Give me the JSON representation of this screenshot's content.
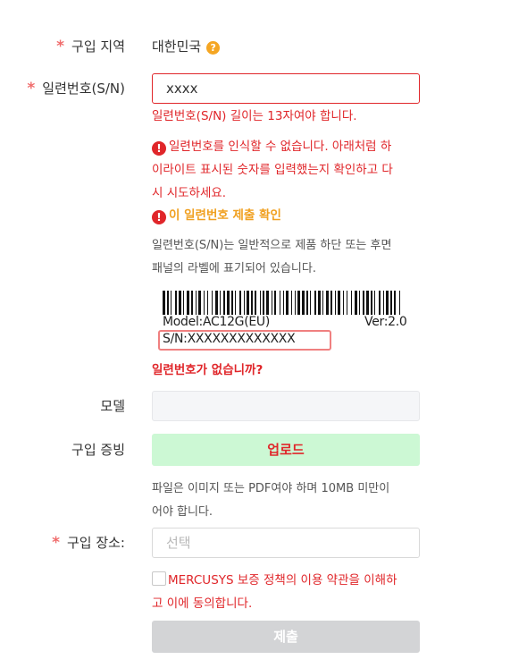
{
  "region": {
    "label": "구입 지역",
    "value": "대한민국",
    "help_icon": "question-icon"
  },
  "serial": {
    "label": "일련번호(S/N)",
    "value": "xxxx",
    "length_error": "일련번호(S/N) 길이는 13자여야 합니다.",
    "recognize_error_1": "일련번호를 인식할 수 없습니다. 아래처럼 하",
    "recognize_error_2": "이라이트 표시된 숫자를 입력했는지 확인하고 다",
    "recognize_error_3": "시 시도하세요.",
    "confirm_link": "이 일련번호 제출 확인",
    "hint_1": "일련번호(S/N)는 일반적으로 제품 하단 또는 후면",
    "hint_2": "패널의 라벨에 표기되어 있습니다.",
    "label_model": "Model:AC12G(EU)",
    "label_ver": "Ver:2.0",
    "label_sn": "S/N:XXXXXXXXXXXXX",
    "no_serial_link": "일련번호가 없습니까?"
  },
  "model": {
    "label": "모델",
    "value": ""
  },
  "proof": {
    "label": "구입 증빙",
    "upload_label": "업로드",
    "hint_1": "파일은 이미지 또는 PDF여야 하며 10MB 미만이",
    "hint_2": "어야 합니다."
  },
  "place": {
    "label": "구입 장소:",
    "placeholder": "선택"
  },
  "agree": {
    "text_1": "MERCUSYS 보증 정책의 이용 약관을 이해하",
    "text_2": "고 이에 동의합니다."
  },
  "submit": {
    "label": "제출"
  },
  "colors": {
    "error": "#e0262a",
    "warning": "#f0a020",
    "upload_bg": "#ccf8d4",
    "submit_disabled_bg": "#d3d4d6"
  }
}
